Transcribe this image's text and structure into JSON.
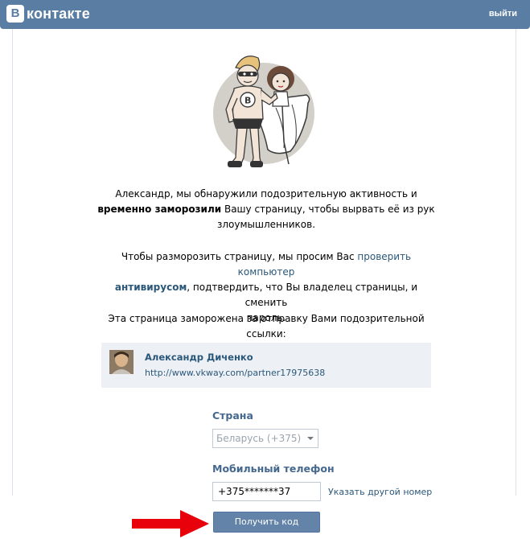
{
  "header": {
    "logo_letter": "B",
    "logo_text": "контакте",
    "logout": "выйти"
  },
  "message": {
    "line1_part1": "Александр, мы обнаружили подозрительную активность и",
    "line2_bold": "временно заморозили",
    "line2_rest": " Вашу страницу, чтобы вырвать её из рук",
    "line3": "злоумышленников.",
    "p2_part1": "Чтобы разморозить страницу, мы просим Вас ",
    "p2_link": "проверить компьютер",
    "p2_link_bold": "антивирусом",
    "p2_part2": ", подтвердить, что Вы владелец страницы, и сменить",
    "p2_part3": "пароль.",
    "p3": "Эта страница заморожена за отправку Вами подозрительной ссылки:"
  },
  "post": {
    "name": "Александр Диченко",
    "url": "http://www.vkway.com/partner17975638"
  },
  "form": {
    "country_label": "Страна",
    "country_value": "Беларусь (+375)",
    "phone_label": "Мобильный телефон",
    "phone_value": "+375*******37",
    "other_number": "Указать другой номер",
    "submit": "Получить код"
  },
  "colors": {
    "header_bg": "#597da3",
    "link": "#2b587a",
    "label": "#45688e",
    "button": "#6383a8",
    "arrow": "#e8000b"
  }
}
